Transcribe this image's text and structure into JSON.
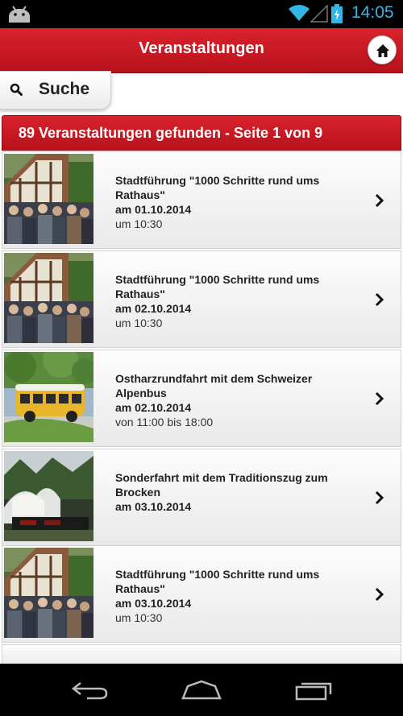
{
  "status_bar": {
    "time": "14:05",
    "icons": [
      "android-icon",
      "wifi-icon",
      "signal-icon",
      "battery-icon"
    ]
  },
  "header": {
    "title": "Veranstaltungen",
    "home_icon": "home-icon"
  },
  "search": {
    "label": "Suche",
    "icon": "search-icon"
  },
  "results": {
    "text": "89 Veranstaltungen gefunden - Seite 1 von 9"
  },
  "events": [
    {
      "title": "Stadtführung \"1000 Schritte rund ums Rathaus\"",
      "date": "am 01.10.2014",
      "time": "um 10:30",
      "thumb": "town-hall"
    },
    {
      "title": "Stadtführung \"1000 Schritte rund ums Rathaus\"",
      "date": "am 02.10.2014",
      "time": "um 10:30",
      "thumb": "town-hall"
    },
    {
      "title": "Ostharzrundfahrt mit dem Schweizer Alpenbus",
      "date": "am 02.10.2014",
      "time": "von 11:00 bis 18:00",
      "thumb": "bus"
    },
    {
      "title": "Sonderfahrt mit dem Traditionszug zum Brocken",
      "date": "am 03.10.2014",
      "time": "",
      "thumb": "train"
    },
    {
      "title": "Stadtführung \"1000 Schritte rund ums Rathaus\"",
      "date": "am 03.10.2014",
      "time": "um 10:30",
      "thumb": "town-hall"
    }
  ],
  "nav_bar": {
    "icons": [
      "back-icon",
      "home-nav-icon",
      "recent-apps-icon"
    ]
  },
  "colors": {
    "header_red": "#c9151f",
    "status_time": "#33b5e5"
  }
}
